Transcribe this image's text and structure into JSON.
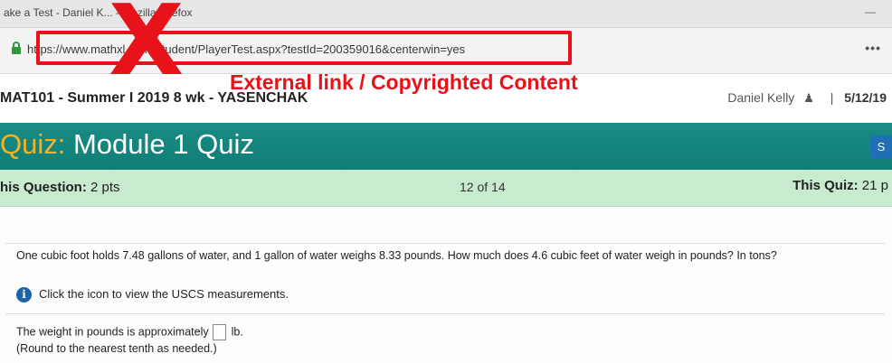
{
  "window": {
    "title": "ake a Test - Daniel K... - Mozilla Firefox",
    "minimize_glyph": "—"
  },
  "browser": {
    "url": "https://www.mathxl.com/Student/PlayerTest.aspx?testId=200359016&centerwin=yes",
    "menu_glyph": "•••"
  },
  "overlay": {
    "mark": "X",
    "caption": "External link / Copyrighted Content",
    "color": "#e8121a"
  },
  "course": {
    "title": "MAT101 - Summer I 2019 8 wk - YASENCHAK",
    "user_name": "Daniel Kelly",
    "user_icon": "user-icon",
    "separator": "|",
    "date": "5/12/19"
  },
  "quiz": {
    "title_prefix": "Quiz:",
    "title": "Module 1 Quiz",
    "save_button": "S",
    "accent_color": "#1a8c83"
  },
  "points": {
    "question_label": "his Question:",
    "question_value": "2 pts",
    "progress": "12 of 14",
    "quiz_label": "This Quiz:",
    "quiz_value": "21 p"
  },
  "question": {
    "text": "One cubic foot holds 7.48 gallons of water, and 1 gallon of water weighs 8.33 pounds. How much does 4.6 cubic feet of water weigh in pounds? In tons?",
    "info_icon": "info-icon",
    "info_text": "Click the icon to view the USCS measurements.",
    "answer_prefix": "The weight in pounds is approximately",
    "answer_value": "",
    "answer_unit": "lb.",
    "hint": "(Round to the nearest tenth as needed.)"
  }
}
